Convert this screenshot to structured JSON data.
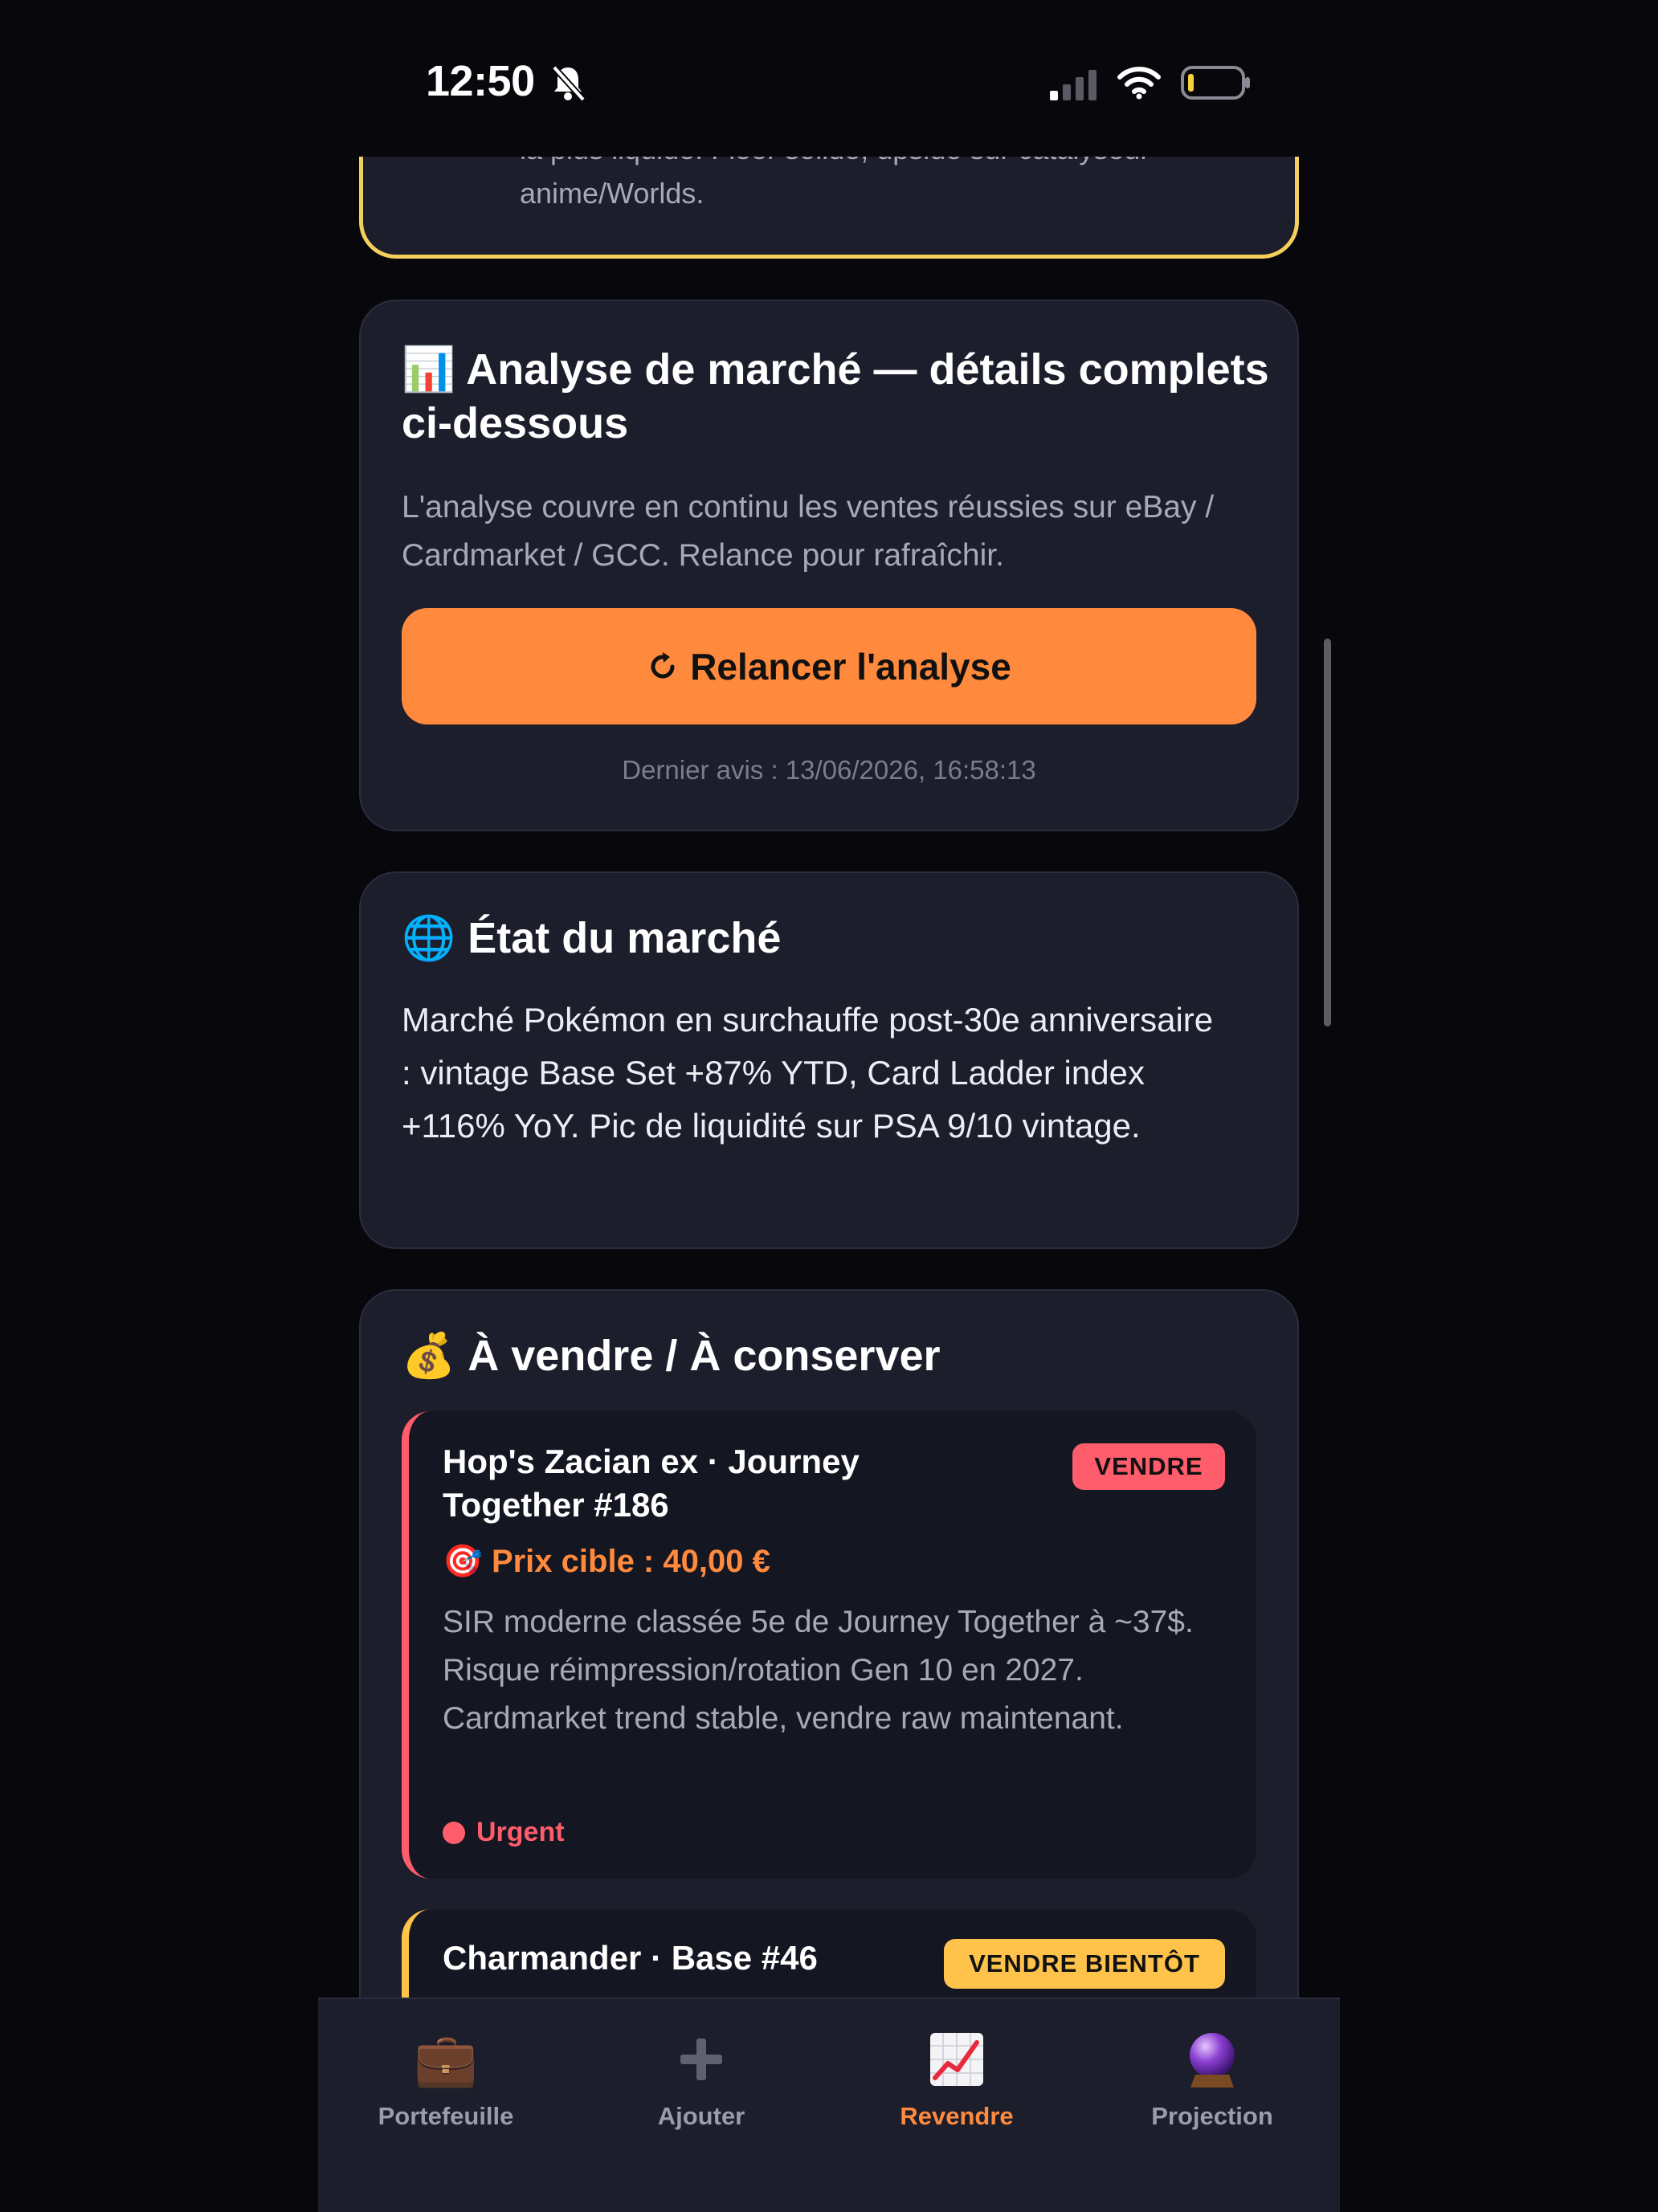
{
  "status": {
    "time": "12:50"
  },
  "top_card": {
    "text_partial": "la plus liquide. Floor solide, upside sur catalyseur",
    "text_last": "anime/Worlds."
  },
  "analysis": {
    "emoji": "📊",
    "title": "Analyse de marché — détails complets ci-dessous",
    "desc": "L'analyse couvre en continu les ventes réussies sur eBay / Cardmarket / GCC. Relance pour rafraîchir.",
    "button_label": "Relancer l'analyse",
    "last_review": "Dernier avis : 13/06/2026, 16:58:13"
  },
  "market": {
    "emoji": "🌐",
    "title": "État du marché",
    "text": "Marché Pokémon en surchauffe post-30e anniversaire : vintage Base Set +87% YTD, Card Ladder index +116% YoY. Pic de liquidité sur PSA 9/10 vintage."
  },
  "sell": {
    "emoji": "💰",
    "title": "À vendre / À conserver",
    "items": [
      {
        "name": "Hop's Zacian ex · Journey Together #186",
        "badge": "VENDRE",
        "target_emoji": "🎯",
        "target": "Prix cible : 40,00 €",
        "desc": "SIR moderne classée 5e de Journey Together à ~37$. Risque réimpression/rotation Gen 10 en 2027. Cardmarket trend stable, vendre raw maintenant.",
        "priority": "Urgent"
      },
      {
        "name": "Charmander · Base #46",
        "badge": "VENDRE BIENTÔT"
      }
    ]
  },
  "tabs": [
    {
      "label": "Portefeuille",
      "icon": "💼"
    },
    {
      "label": "Ajouter",
      "icon": "➕"
    },
    {
      "label": "Revendre",
      "icon": "📈"
    },
    {
      "label": "Projection",
      "icon": "🔮"
    }
  ],
  "colors": {
    "accent": "#ff8a3d",
    "urgent": "#ff5c6c",
    "warning": "#ffc24a",
    "card": "#1c1e2c",
    "background": "#08080c"
  }
}
